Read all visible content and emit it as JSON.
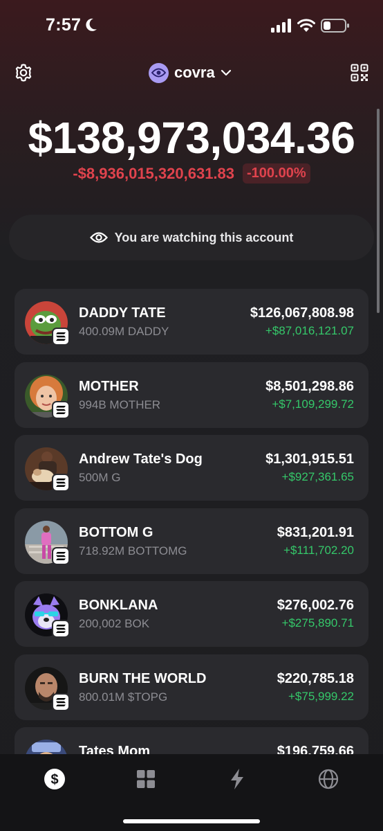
{
  "status_bar": {
    "time": "7:57"
  },
  "header": {
    "account_name": "covra"
  },
  "portfolio": {
    "balance": "$138,973,034.36",
    "change_amount": "-$8,936,015,320,631.83",
    "change_percent": "-100.00%"
  },
  "banner": {
    "text": "You are watching this account"
  },
  "tokens": [
    {
      "name": "DADDY TATE",
      "quantity": "400.09M DADDY",
      "value": "$126,067,808.98",
      "gain": "+$87,016,121.07",
      "avatar": "pepe-frog-avatar"
    },
    {
      "name": "MOTHER",
      "quantity": "994B MOTHER",
      "value": "$8,501,298.86",
      "gain": "+$7,109,299.72",
      "avatar": "woman-portrait-avatar"
    },
    {
      "name": "Andrew Tate's Dog",
      "quantity": "500M G",
      "value": "$1,301,915.51",
      "gain": "+$927,361.65",
      "avatar": "man-with-dog-avatar"
    },
    {
      "name": "BOTTOM G",
      "quantity": "718.92M BOTTOMG",
      "value": "$831,201.91",
      "gain": "+$111,702.20",
      "avatar": "pink-figure-avatar"
    },
    {
      "name": "BONKLANA",
      "quantity": "200,002 BOK",
      "value": "$276,002.76",
      "gain": "+$275,890.71",
      "avatar": "dog-sunglasses-avatar"
    },
    {
      "name": "BURN THE WORLD",
      "quantity": "800.01M $TOPG",
      "value": "$220,785.18",
      "gain": "+$75,999.22",
      "avatar": "bald-man-avatar"
    },
    {
      "name": "Tates Mom",
      "quantity": "",
      "value": "$196,759.66",
      "gain": "",
      "avatar": "partial-avatar"
    }
  ],
  "tab_bar": {
    "tabs": [
      {
        "icon": "dollar-icon",
        "active": true
      },
      {
        "icon": "grid-icon",
        "active": false
      },
      {
        "icon": "lightning-icon",
        "active": false
      },
      {
        "icon": "globe-icon",
        "active": false
      }
    ]
  },
  "colors": {
    "negative": "#e0434d",
    "positive": "#35c86a",
    "accent_avatar": "#a99bf2",
    "card": "#2a2a2e"
  }
}
